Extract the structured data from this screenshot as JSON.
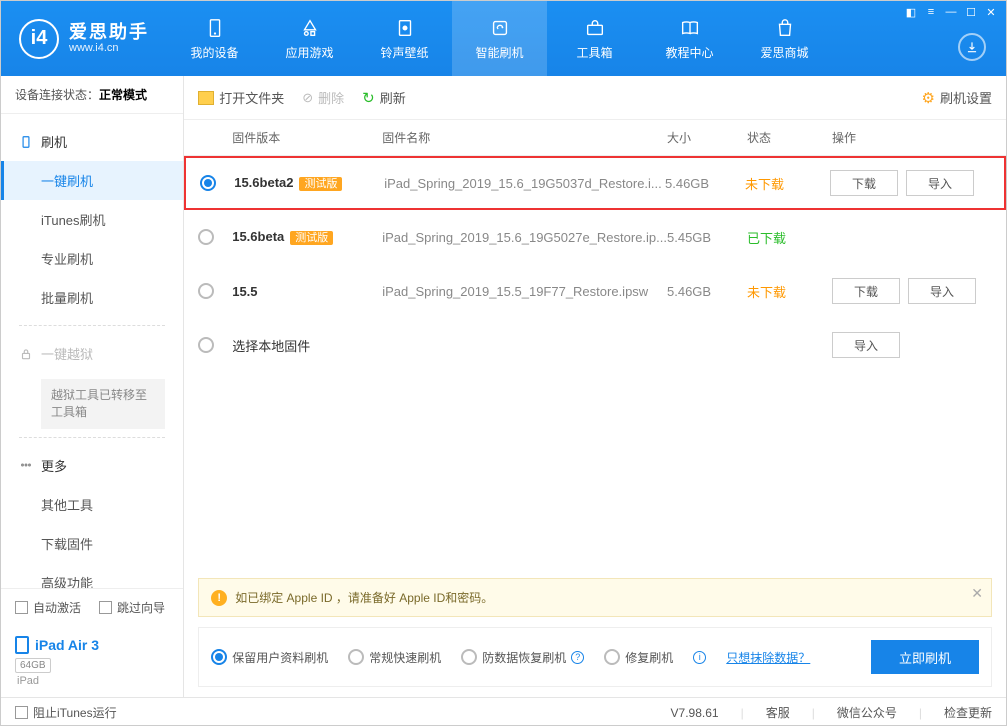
{
  "app": {
    "title": "爱思助手",
    "url": "www.i4.cn"
  },
  "nav": [
    {
      "label": "我的设备"
    },
    {
      "label": "应用游戏"
    },
    {
      "label": "铃声壁纸"
    },
    {
      "label": "智能刷机"
    },
    {
      "label": "工具箱"
    },
    {
      "label": "教程中心"
    },
    {
      "label": "爱思商城"
    }
  ],
  "sidebar": {
    "status_label": "设备连接状态：",
    "status_value": "正常模式",
    "groups": {
      "flash": "刷机",
      "jailbreak": "一键越狱",
      "more": "更多"
    },
    "flash_subs": [
      "一键刷机",
      "iTunes刷机",
      "专业刷机",
      "批量刷机"
    ],
    "jailbreak_note": "越狱工具已转移至工具箱",
    "more_subs": [
      "其他工具",
      "下载固件",
      "高级功能"
    ],
    "auto_activate": "自动激活",
    "skip_guide": "跳过向导",
    "device_name": "iPad Air 3",
    "device_storage": "64GB",
    "device_type": "iPad"
  },
  "toolbar": {
    "open_folder": "打开文件夹",
    "delete": "删除",
    "refresh": "刷新",
    "settings": "刷机设置"
  },
  "table": {
    "headers": {
      "version": "固件版本",
      "name": "固件名称",
      "size": "大小",
      "status": "状态",
      "ops": "操作"
    },
    "rows": [
      {
        "version": "15.6beta2",
        "beta": "测试版",
        "name": "iPad_Spring_2019_15.6_19G5037d_Restore.i...",
        "size": "5.46GB",
        "status": "未下载",
        "status_class": "undl",
        "checked": true,
        "show_ops": true
      },
      {
        "version": "15.6beta",
        "beta": "测试版",
        "name": "iPad_Spring_2019_15.6_19G5027e_Restore.ip...",
        "size": "5.45GB",
        "status": "已下载",
        "status_class": "dl",
        "checked": false,
        "show_ops": false
      },
      {
        "version": "15.5",
        "beta": "",
        "name": "iPad_Spring_2019_15.5_19F77_Restore.ipsw",
        "size": "5.46GB",
        "status": "未下载",
        "status_class": "undl",
        "checked": false,
        "show_ops": true
      }
    ],
    "local_row": "选择本地固件",
    "btn_download": "下载",
    "btn_import": "导入"
  },
  "notice": "如已绑定 Apple ID ，请准备好 Apple ID和密码。",
  "options": {
    "opt1": "保留用户资料刷机",
    "opt2": "常规快速刷机",
    "opt3": "防数据恢复刷机",
    "opt4": "修复刷机",
    "erase_link": "只想抹除数据？",
    "flash_now": "立即刷机"
  },
  "footer": {
    "block_itunes": "阻止iTunes运行",
    "version": "V7.98.61",
    "support": "客服",
    "wechat": "微信公众号",
    "check_update": "检查更新"
  }
}
